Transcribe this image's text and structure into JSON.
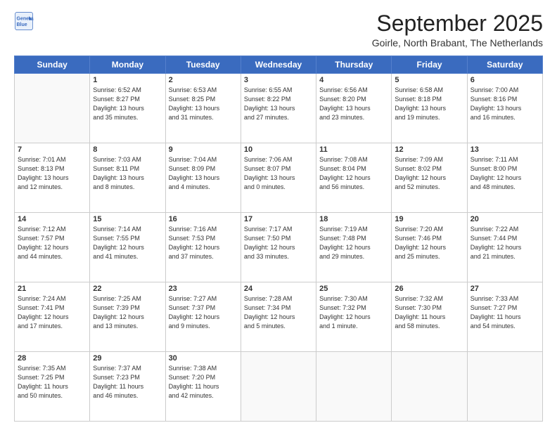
{
  "header": {
    "logo_line1": "General",
    "logo_line2": "Blue",
    "month_title": "September 2025",
    "location": "Goirle, North Brabant, The Netherlands"
  },
  "weekdays": [
    "Sunday",
    "Monday",
    "Tuesday",
    "Wednesday",
    "Thursday",
    "Friday",
    "Saturday"
  ],
  "weeks": [
    [
      {
        "day": "",
        "info": ""
      },
      {
        "day": "1",
        "info": "Sunrise: 6:52 AM\nSunset: 8:27 PM\nDaylight: 13 hours\nand 35 minutes."
      },
      {
        "day": "2",
        "info": "Sunrise: 6:53 AM\nSunset: 8:25 PM\nDaylight: 13 hours\nand 31 minutes."
      },
      {
        "day": "3",
        "info": "Sunrise: 6:55 AM\nSunset: 8:22 PM\nDaylight: 13 hours\nand 27 minutes."
      },
      {
        "day": "4",
        "info": "Sunrise: 6:56 AM\nSunset: 8:20 PM\nDaylight: 13 hours\nand 23 minutes."
      },
      {
        "day": "5",
        "info": "Sunrise: 6:58 AM\nSunset: 8:18 PM\nDaylight: 13 hours\nand 19 minutes."
      },
      {
        "day": "6",
        "info": "Sunrise: 7:00 AM\nSunset: 8:16 PM\nDaylight: 13 hours\nand 16 minutes."
      }
    ],
    [
      {
        "day": "7",
        "info": "Sunrise: 7:01 AM\nSunset: 8:13 PM\nDaylight: 13 hours\nand 12 minutes."
      },
      {
        "day": "8",
        "info": "Sunrise: 7:03 AM\nSunset: 8:11 PM\nDaylight: 13 hours\nand 8 minutes."
      },
      {
        "day": "9",
        "info": "Sunrise: 7:04 AM\nSunset: 8:09 PM\nDaylight: 13 hours\nand 4 minutes."
      },
      {
        "day": "10",
        "info": "Sunrise: 7:06 AM\nSunset: 8:07 PM\nDaylight: 13 hours\nand 0 minutes."
      },
      {
        "day": "11",
        "info": "Sunrise: 7:08 AM\nSunset: 8:04 PM\nDaylight: 12 hours\nand 56 minutes."
      },
      {
        "day": "12",
        "info": "Sunrise: 7:09 AM\nSunset: 8:02 PM\nDaylight: 12 hours\nand 52 minutes."
      },
      {
        "day": "13",
        "info": "Sunrise: 7:11 AM\nSunset: 8:00 PM\nDaylight: 12 hours\nand 48 minutes."
      }
    ],
    [
      {
        "day": "14",
        "info": "Sunrise: 7:12 AM\nSunset: 7:57 PM\nDaylight: 12 hours\nand 44 minutes."
      },
      {
        "day": "15",
        "info": "Sunrise: 7:14 AM\nSunset: 7:55 PM\nDaylight: 12 hours\nand 41 minutes."
      },
      {
        "day": "16",
        "info": "Sunrise: 7:16 AM\nSunset: 7:53 PM\nDaylight: 12 hours\nand 37 minutes."
      },
      {
        "day": "17",
        "info": "Sunrise: 7:17 AM\nSunset: 7:50 PM\nDaylight: 12 hours\nand 33 minutes."
      },
      {
        "day": "18",
        "info": "Sunrise: 7:19 AM\nSunset: 7:48 PM\nDaylight: 12 hours\nand 29 minutes."
      },
      {
        "day": "19",
        "info": "Sunrise: 7:20 AM\nSunset: 7:46 PM\nDaylight: 12 hours\nand 25 minutes."
      },
      {
        "day": "20",
        "info": "Sunrise: 7:22 AM\nSunset: 7:44 PM\nDaylight: 12 hours\nand 21 minutes."
      }
    ],
    [
      {
        "day": "21",
        "info": "Sunrise: 7:24 AM\nSunset: 7:41 PM\nDaylight: 12 hours\nand 17 minutes."
      },
      {
        "day": "22",
        "info": "Sunrise: 7:25 AM\nSunset: 7:39 PM\nDaylight: 12 hours\nand 13 minutes."
      },
      {
        "day": "23",
        "info": "Sunrise: 7:27 AM\nSunset: 7:37 PM\nDaylight: 12 hours\nand 9 minutes."
      },
      {
        "day": "24",
        "info": "Sunrise: 7:28 AM\nSunset: 7:34 PM\nDaylight: 12 hours\nand 5 minutes."
      },
      {
        "day": "25",
        "info": "Sunrise: 7:30 AM\nSunset: 7:32 PM\nDaylight: 12 hours\nand 1 minute."
      },
      {
        "day": "26",
        "info": "Sunrise: 7:32 AM\nSunset: 7:30 PM\nDaylight: 11 hours\nand 58 minutes."
      },
      {
        "day": "27",
        "info": "Sunrise: 7:33 AM\nSunset: 7:27 PM\nDaylight: 11 hours\nand 54 minutes."
      }
    ],
    [
      {
        "day": "28",
        "info": "Sunrise: 7:35 AM\nSunset: 7:25 PM\nDaylight: 11 hours\nand 50 minutes."
      },
      {
        "day": "29",
        "info": "Sunrise: 7:37 AM\nSunset: 7:23 PM\nDaylight: 11 hours\nand 46 minutes."
      },
      {
        "day": "30",
        "info": "Sunrise: 7:38 AM\nSunset: 7:20 PM\nDaylight: 11 hours\nand 42 minutes."
      },
      {
        "day": "",
        "info": ""
      },
      {
        "day": "",
        "info": ""
      },
      {
        "day": "",
        "info": ""
      },
      {
        "day": "",
        "info": ""
      }
    ]
  ]
}
